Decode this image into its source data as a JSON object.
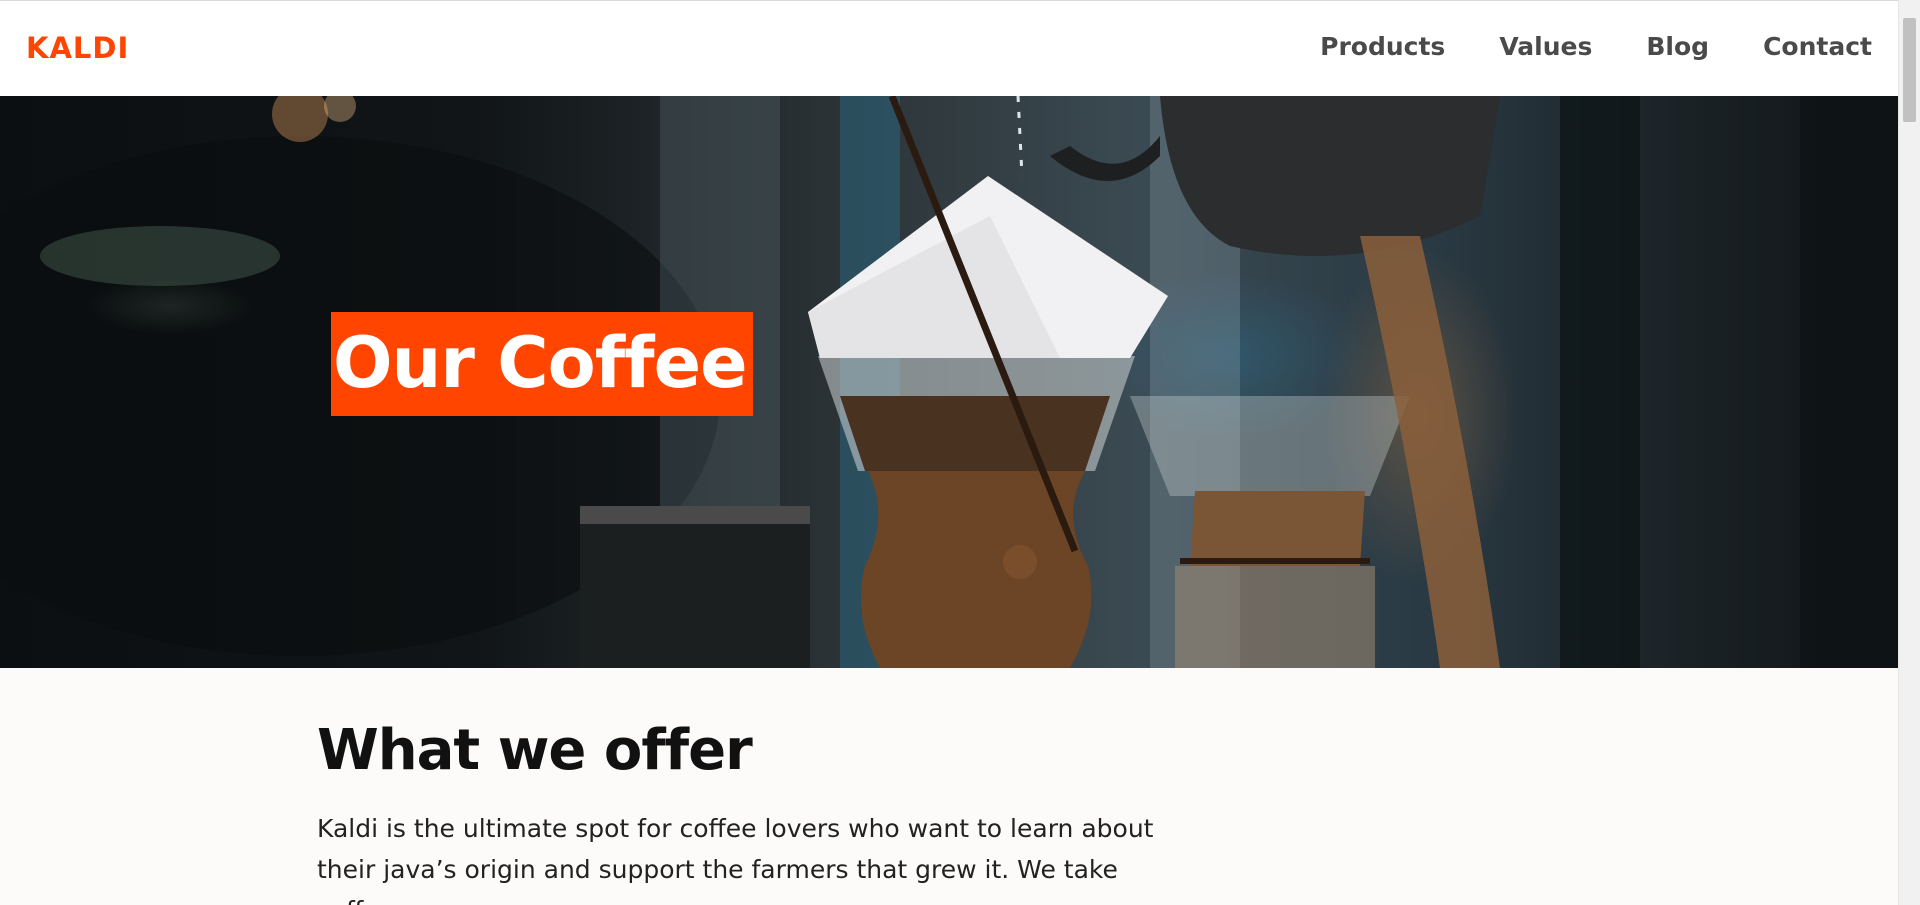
{
  "brand": {
    "logo_text": "KALDI",
    "color": "#ff4500"
  },
  "nav": {
    "items": [
      {
        "label": "Products"
      },
      {
        "label": "Values"
      },
      {
        "label": "Blog"
      },
      {
        "label": "Contact"
      }
    ],
    "text_color": "#4a4a4a"
  },
  "hero": {
    "title": "Our Coffee",
    "title_background": "#ff4500",
    "image_subject": "pour-over coffee brewers photo"
  },
  "section": {
    "heading": "What we offer",
    "body": "Kaldi is the ultimate spot for coffee lovers who want to learn about their java’s origin and support the farmers that grew it. We take coffee"
  },
  "colors": {
    "accent": "#ff4500",
    "page_background": "#fcfbfa"
  }
}
